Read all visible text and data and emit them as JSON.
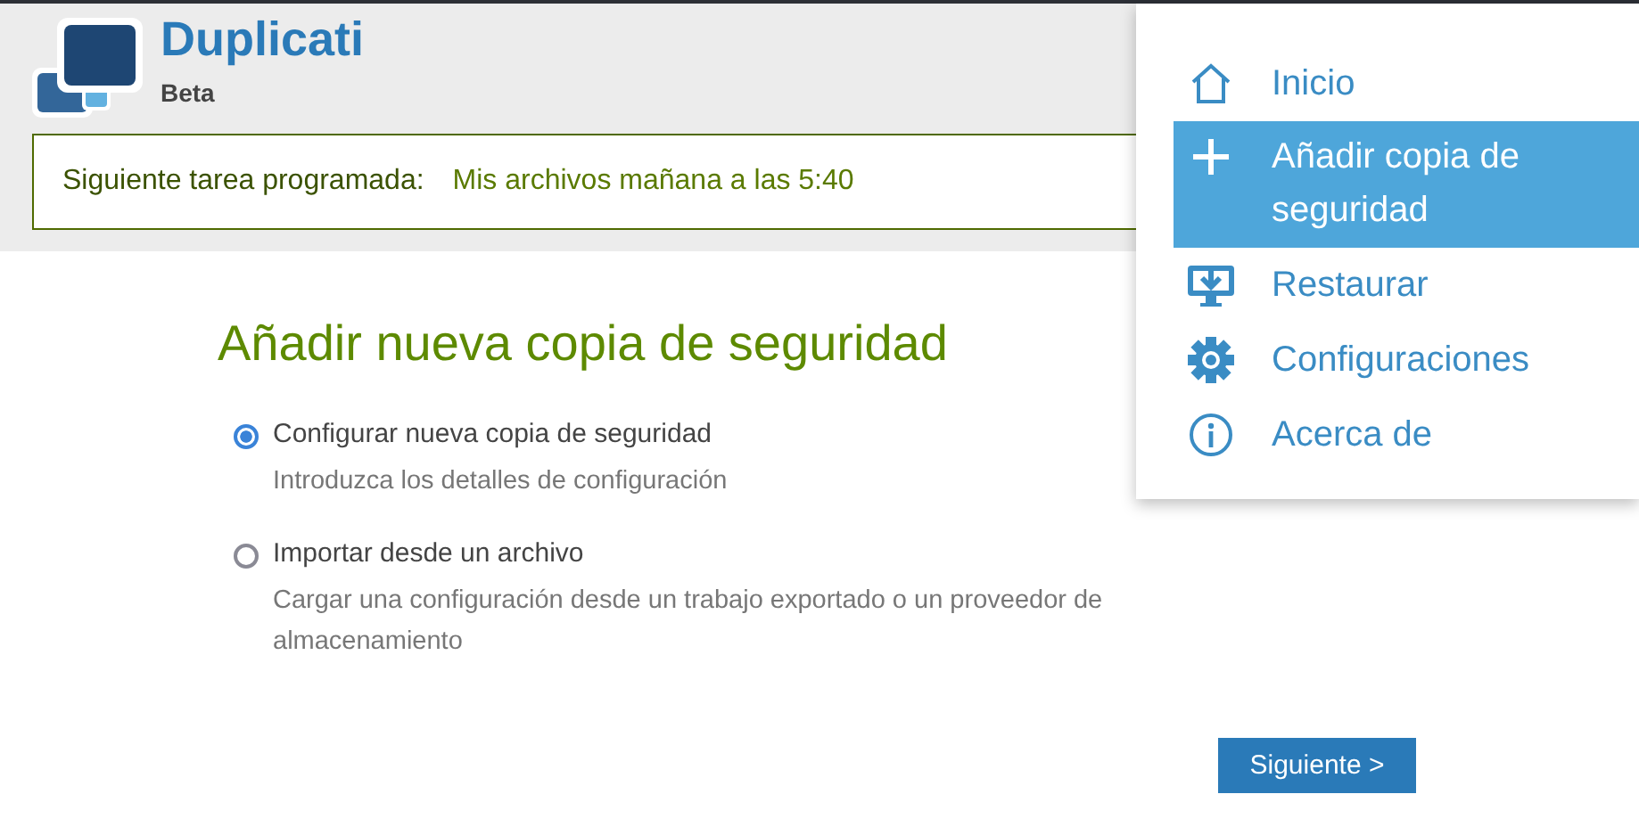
{
  "header": {
    "title": "Duplicati",
    "subtitle": "Beta"
  },
  "notice": {
    "label": "Siguiente tarea programada:",
    "value": "Mis archivos mañana a las 5:40"
  },
  "heading": "Añadir nueva copia de seguridad",
  "options": [
    {
      "label": "Configurar nueva copia de seguridad",
      "description": "Introduzca los detalles de configuración",
      "selected": true
    },
    {
      "label": "Importar desde un archivo",
      "description": "Cargar una configuración desde un trabajo exportado o un proveedor de almacenamiento",
      "selected": false
    }
  ],
  "next_button": "Siguiente >",
  "menu": {
    "items": [
      {
        "label": "Inicio",
        "selected": false
      },
      {
        "label": "Añadir copia de seguridad",
        "selected": true
      },
      {
        "label": "Restaurar",
        "selected": false
      },
      {
        "label": "Configuraciones",
        "selected": false
      },
      {
        "label": "Acerca de",
        "selected": false
      }
    ]
  }
}
